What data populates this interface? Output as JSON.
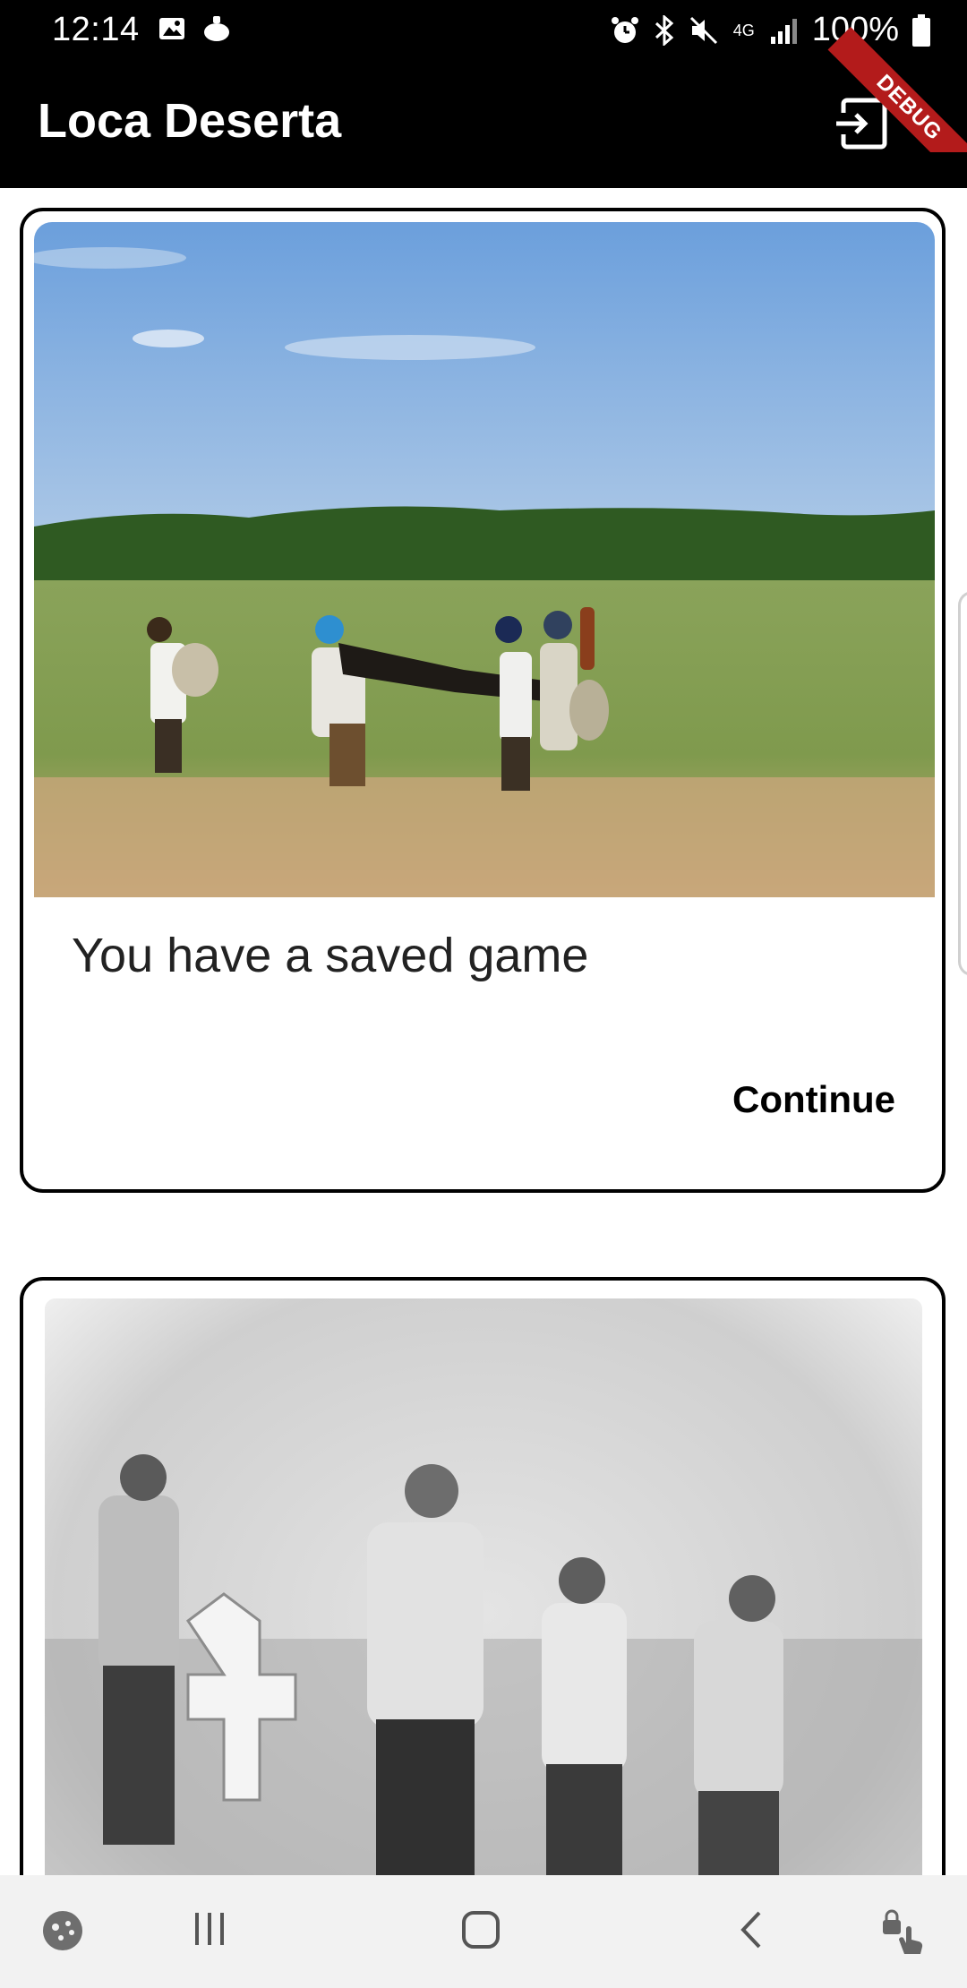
{
  "status_bar": {
    "time": "12:14",
    "battery": "100%",
    "network": "4G",
    "icons": [
      "image-icon",
      "cooking-pot-icon",
      "alarm-icon",
      "bluetooth-icon",
      "mute-icon",
      "network-4g-icon",
      "signal-icon",
      "battery-icon"
    ]
  },
  "app_bar": {
    "title": "Loca Deserta",
    "action_icon": "exit-icon",
    "debug_label": "DEBUG"
  },
  "cards": [
    {
      "image": "photo-people-walking-in-field",
      "text": "You have a saved game",
      "button_label": "Continue"
    },
    {
      "image": "sketch-group-of-men-with-stone-cross"
    }
  ],
  "nav_bar": {
    "icons": [
      "game-launcher-icon",
      "recent-apps-icon",
      "home-icon",
      "back-icon",
      "touch-lock-icon"
    ]
  }
}
